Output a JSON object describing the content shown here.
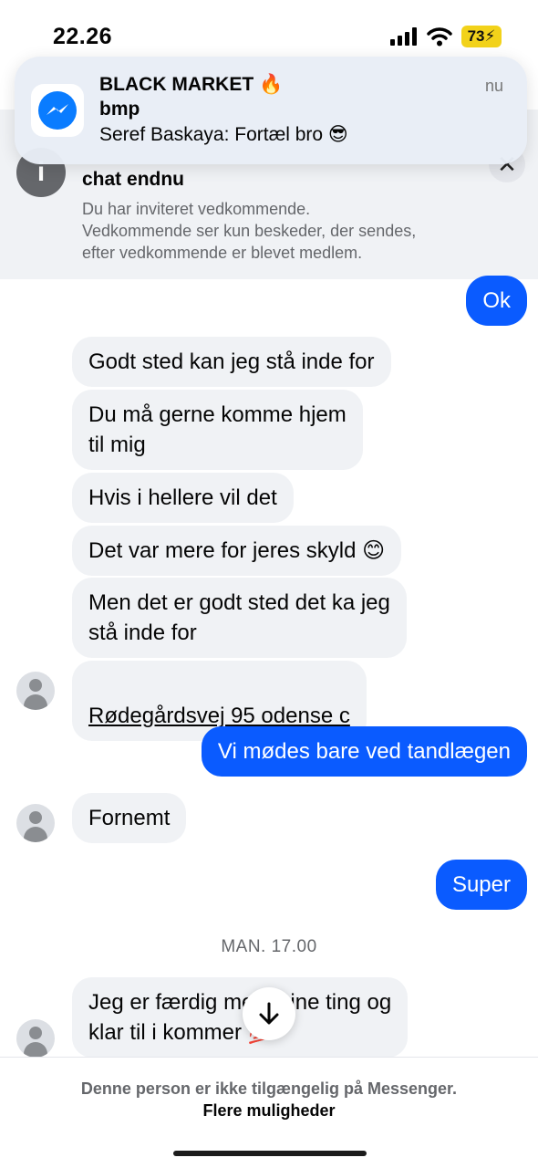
{
  "status_bar": {
    "time": "22.26",
    "battery": "73"
  },
  "notification": {
    "title": "BLACK MARKET 🔥",
    "subtitle": "bmp",
    "body": "Seref Baskaya: Fortæl bro 😎",
    "time": "nu",
    "app_icon": "messenger-icon"
  },
  "invite_banner": {
    "title": "chat endnu",
    "description": "Du har inviteret vedkommende.\nVedkommende ser kun beskeder, der sendes,\nefter vedkommende er blevet medlem."
  },
  "messages": [
    {
      "dir": "out",
      "text": "Ok"
    },
    {
      "dir": "in",
      "text": "Godt sted kan jeg stå inde for"
    },
    {
      "dir": "in",
      "text": "Du må gerne komme hjem\ntil mig"
    },
    {
      "dir": "in",
      "text": "Hvis i hellere vil det"
    },
    {
      "dir": "in",
      "text": "Det var mere for jeres skyld 😊"
    },
    {
      "dir": "in",
      "text": "Men det er godt sted det ka jeg\nstå inde for"
    },
    {
      "dir": "in",
      "text": "Rødegårdsvej 95 odense c"
    },
    {
      "dir": "out",
      "text": "Vi mødes bare ved tandlægen"
    },
    {
      "dir": "in",
      "text": "Fornemt"
    },
    {
      "dir": "out",
      "text": "Super"
    },
    {
      "dir": "in",
      "text": "Jeg er færdig med mine ting og\nklar til i kommer 💯"
    }
  ],
  "timestamp": "MAN. 17.00",
  "bottom": {
    "unavailable": "Denne person er ikke tilgængelig på Messenger.",
    "more_options": "Flere muligheder"
  },
  "colors": {
    "outgoing_bubble": "#0a5bff",
    "incoming_bubble": "#f0f2f5",
    "battery": "#f2d21a"
  }
}
